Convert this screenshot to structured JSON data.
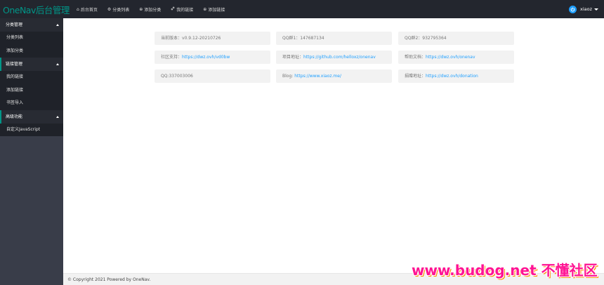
{
  "app": {
    "logo": "OneNav后台管理"
  },
  "topnav": [
    {
      "icon": "home-icon",
      "glyph": "⌂",
      "label": "后台首页"
    },
    {
      "icon": "gear-icon",
      "glyph": "⚙",
      "label": "分类列表"
    },
    {
      "icon": "add-circle-icon",
      "glyph": "⊕",
      "label": "添加分类"
    },
    {
      "icon": "link-icon",
      "glyph": "🔗",
      "label": "我的链接"
    },
    {
      "icon": "add-circle-icon",
      "glyph": "⊕",
      "label": "添加链接"
    }
  ],
  "user": {
    "name": "xiaoz"
  },
  "sidebar": {
    "groups": [
      {
        "label": "分类管理",
        "items": [
          "分类列表",
          "添加分类"
        ]
      },
      {
        "label": "链接管理",
        "items": [
          "我的链接",
          "添加链接",
          "书签导入"
        ]
      },
      {
        "label": "高级功能",
        "items": [
          "自定义JavaScript"
        ]
      }
    ]
  },
  "info": {
    "version": {
      "label": "当前版本：",
      "value": "v0.9.12-20210726"
    },
    "qq1": {
      "label": "QQ群1：",
      "value": "147687134"
    },
    "qq2": {
      "label": "QQ群2：",
      "value": "932795364"
    },
    "community": {
      "label": "社区支持：",
      "value": "https://dwz.ovh/vd0bw"
    },
    "project": {
      "label": "项目地址：",
      "value": "https://github.com/helloxz/onenav"
    },
    "help": {
      "label": "帮助文档：",
      "value": "https://dwz.ovh/onenav"
    },
    "qq": {
      "label": "QQ:",
      "value": "337003006"
    },
    "blog": {
      "label": "Blog: ",
      "value": "https://www.xiaoz.me/"
    },
    "donate": {
      "label": "捐赠地址：",
      "value": "https://dwz.ovh/donation"
    }
  },
  "footer": {
    "text": "© Copyright 2021 Powered by OneNav."
  },
  "watermark": {
    "text": "www.budog.net 不懂社区"
  },
  "colors": {
    "topbar": "#23262e",
    "sidebar": "#393d49",
    "accent": "#009688",
    "link": "#1e9fff"
  }
}
